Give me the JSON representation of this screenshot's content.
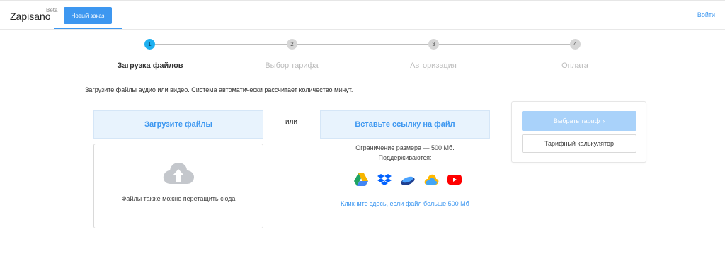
{
  "header": {
    "logo": "Zapisano",
    "beta": "Beta",
    "new_order": "Новый заказ",
    "login": "Войти"
  },
  "steps": [
    {
      "num": "1",
      "label": "Загрузка файлов"
    },
    {
      "num": "2",
      "label": "Выбор тарифа"
    },
    {
      "num": "3",
      "label": "Авторизация"
    },
    {
      "num": "4",
      "label": "Оплата"
    }
  ],
  "active_step": 1,
  "intro": "Загрузите файлы аудио или видео. Система автоматически рассчитает количество минут.",
  "upload": {
    "button": "Загрузите файлы",
    "drop_text": "Файлы также можно перетащить сюда"
  },
  "or": "или",
  "link": {
    "button": "Вставьте ссылку на файл",
    "limit": "Ограничение размера — 500 Мб.",
    "supports": "Поддерживаются:",
    "services": [
      "google-drive-icon",
      "dropbox-icon",
      "yandex-disk-icon",
      "mail-cloud-icon",
      "youtube-icon"
    ],
    "big_file": "Кликните здесь, если файл больше 500 Мб"
  },
  "side": {
    "choose_tariff": "Выбрать тариф",
    "chevron": "›",
    "calculator": "Тарифный калькулятор"
  },
  "colors": {
    "accent": "#3d97f0",
    "step_active": "#1eb0f0",
    "button_bg": "#e8f3fd",
    "disabled_btn": "#a9d2fa"
  }
}
